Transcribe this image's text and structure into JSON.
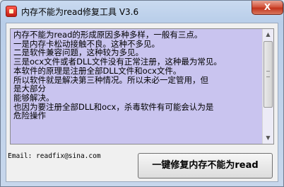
{
  "window": {
    "title": "内存不能为read修复工具 V3.6",
    "close_label": "X"
  },
  "description_lines": [
    "内存不能为read的形成原因多种多样，一般有三点。",
    "一是内存卡松动接触不良。这种不多见。",
    "二是软件兼容问题，这种较为多见。",
    "三是ocx文件或者DLL文件没有正常注册，这种最为常见。",
    "本软件的原理是注册全部DLL文件和ocx文件。",
    "所以软件就是解决第三种情况。所以未必一定管用，但",
    "是大部分",
    "能够解决。",
    "也因为要注册全部DLL和ocx，杀毒软件有可能会认为是",
    "危险操作"
  ],
  "email_text": "Email: readfix@sina.com",
  "repair_button_label": "一键修复内存不能为read",
  "scrollbar": {
    "up_arrow": "▲",
    "down_arrow": "▼"
  }
}
